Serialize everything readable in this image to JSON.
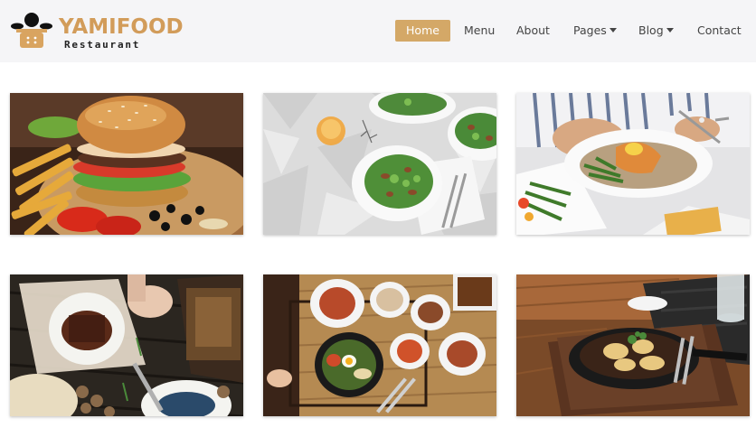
{
  "brand": {
    "name": "YAMIFOOD",
    "tagline": "Restaurant",
    "accent": "#d4a867"
  },
  "nav": {
    "items": [
      {
        "label": "Home",
        "active": true
      },
      {
        "label": "Menu"
      },
      {
        "label": "About"
      },
      {
        "label": "Pages",
        "dropdown": true
      },
      {
        "label": "Blog",
        "dropdown": true
      },
      {
        "label": "Contact"
      }
    ]
  },
  "gallery": {
    "images": [
      {
        "subject": "burger with fries, tomato and olives"
      },
      {
        "subject": "green salad plates on tiled table"
      },
      {
        "subject": "salmon fillet with green beans"
      },
      {
        "subject": "grilled meat and dishes on dark wooden table"
      },
      {
        "subject": "korean bibimbap with side dishes"
      },
      {
        "subject": "sizzling skillet dish with drink"
      }
    ]
  }
}
